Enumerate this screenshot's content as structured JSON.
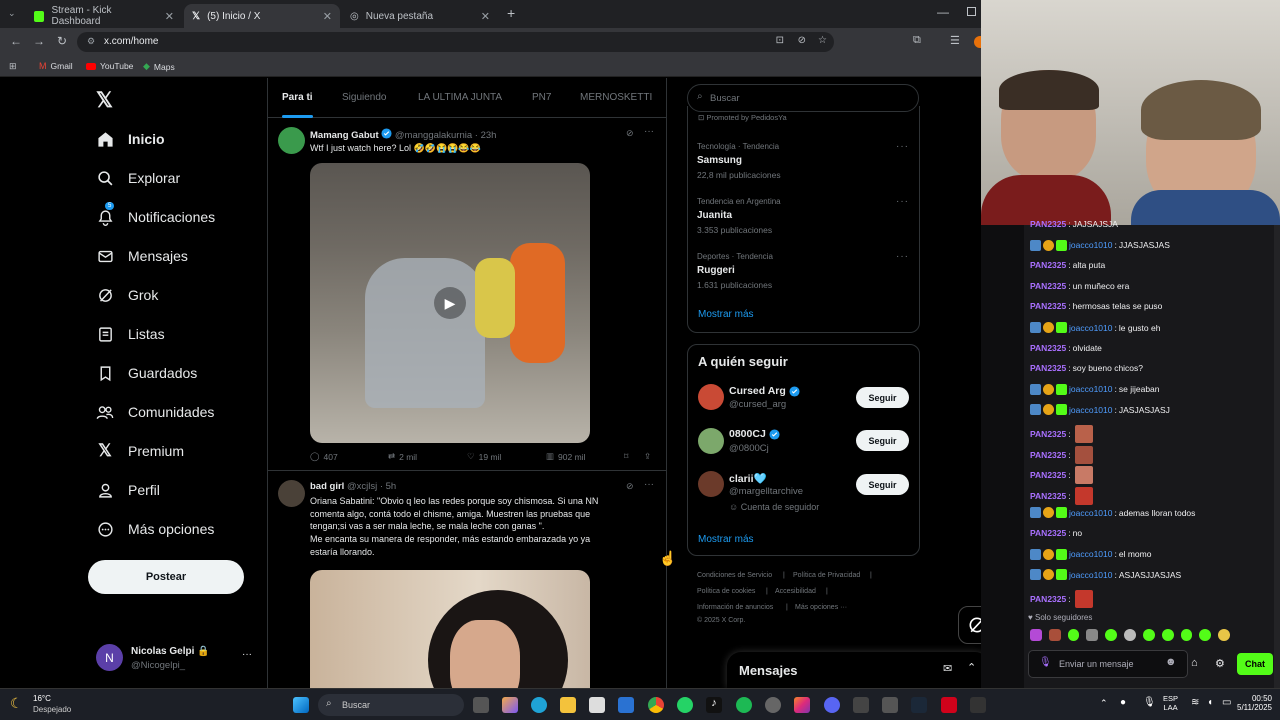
{
  "browser": {
    "tabs": [
      {
        "label": "Stream - Kick Dashboard"
      },
      {
        "label": "(5) Inicio / X"
      },
      {
        "label": "Nueva pestaña"
      }
    ],
    "url": "x.com/home",
    "bookmarks": [
      "Gmail",
      "YouTube",
      "Maps"
    ]
  },
  "x": {
    "nav": [
      {
        "label": "Inicio",
        "icon": "home-icon"
      },
      {
        "label": "Explorar",
        "icon": "search-icon"
      },
      {
        "label": "Notificaciones",
        "icon": "bell-icon",
        "badge": "5"
      },
      {
        "label": "Mensajes",
        "icon": "mail-icon"
      },
      {
        "label": "Grok",
        "icon": "grok-icon"
      },
      {
        "label": "Listas",
        "icon": "list-icon"
      },
      {
        "label": "Guardados",
        "icon": "bookmark-icon"
      },
      {
        "label": "Comunidades",
        "icon": "people-icon"
      },
      {
        "label": "Premium",
        "icon": "x-logo-icon"
      },
      {
        "label": "Perfil",
        "icon": "person-icon"
      },
      {
        "label": "Más opciones",
        "icon": "more-circle-icon"
      }
    ],
    "post_button": "Postear",
    "account": {
      "initial": "N",
      "name": "Nicolas Gelpi",
      "handle": "@Nicogelpi_"
    },
    "timeline_tabs": [
      "Para ti",
      "Siguiendo",
      "LA ULTIMA JUNTA",
      "PN7",
      "MERNOSKETTI"
    ],
    "posts": [
      {
        "name": "Mamang Gabut",
        "handle": "@manggalakurnia · 23h",
        "text": "Wtf I just watch here? Lol 🤣🤣😭😭😂😂",
        "metrics": {
          "replies": "407",
          "reposts": "2 mil",
          "likes": "19 mil",
          "views": "902 mil"
        }
      },
      {
        "name": "bad girl",
        "handle": "@xcjlsj · 5h",
        "text_lines": [
          "Oriana Sabatini: \"Obvio q leo las redes porque soy chismosa. Si una NN",
          "comenta algo, contá todo el chisme, amiga. Muestren las pruebas que",
          "tengan;si vas a ser mala leche, se mala leche con ganas \".",
          "Me encanta su manera de responder, más estando embarazada yo ya",
          "estaría llorando."
        ]
      }
    ],
    "search_placeholder": "Buscar",
    "promoted": "Promoted by PedidosYa",
    "trends": [
      {
        "category": "Tecnología · Tendencia",
        "name": "Samsung",
        "count": "22,8 mil publicaciones"
      },
      {
        "category": "Tendencia en Argentina",
        "name": "Juanita",
        "count": "3.353 publicaciones"
      },
      {
        "category": "Deportes · Tendencia",
        "name": "Ruggeri",
        "count": "1.631 publicaciones"
      }
    ],
    "show_more": "Mostrar más",
    "who_to_follow": {
      "title": "A quién seguir",
      "users": [
        {
          "name": "Cursed Arg",
          "handle": "@cursed_arg",
          "verified": true
        },
        {
          "name": "0800CJ",
          "handle": "@0800Cj",
          "verified": true
        },
        {
          "name": "clarii🩵",
          "handle": "@margelltarchive",
          "note": "Cuenta de seguidor",
          "verified": false
        }
      ],
      "follow_label": "Seguir",
      "show_more": "Mostrar más"
    },
    "footer_links": [
      "Condiciones de Servicio",
      "|",
      "Política de Privacidad",
      "|",
      "Política de cookies",
      "|",
      "Accesibilidad",
      "|",
      "Información de anuncios",
      "|",
      "Más opciones ···",
      "© 2025 X Corp."
    ],
    "messages_label": "Mensajes"
  },
  "chat": {
    "messages": [
      {
        "user": "PAN2325",
        "text": "JAJSAJSJA",
        "type": "pan"
      },
      {
        "user": "joacco1010",
        "text": "JJASJASJAS",
        "type": "joa"
      },
      {
        "user": "PAN2325",
        "text": "alta puta",
        "type": "pan"
      },
      {
        "user": "PAN2325",
        "text": "un muñeco era",
        "type": "pan"
      },
      {
        "user": "PAN2325",
        "text": "hermosas telas se puso",
        "type": "pan"
      },
      {
        "user": "joacco1010",
        "text": "le gusto eh",
        "type": "joa"
      },
      {
        "user": "PAN2325",
        "text": "olvidate",
        "type": "pan"
      },
      {
        "user": "PAN2325",
        "text": "soy bueno chicos?",
        "type": "pan"
      },
      {
        "user": "joacco1010",
        "text": "se jijeaban",
        "type": "joa"
      },
      {
        "user": "joacco1010",
        "text": "JASJASJASJ",
        "type": "joa"
      },
      {
        "user": "PAN2325",
        "text": "",
        "type": "pan",
        "emote": true
      },
      {
        "user": "PAN2325",
        "text": "",
        "type": "pan",
        "emote": true
      },
      {
        "user": "PAN2325",
        "text": "",
        "type": "pan",
        "emote": true
      },
      {
        "user": "PAN2325",
        "text": "",
        "type": "pan",
        "emote": true
      },
      {
        "user": "joacco1010",
        "text": "ademas lloran todos",
        "type": "joa"
      },
      {
        "user": "PAN2325",
        "text": "no",
        "type": "pan"
      },
      {
        "user": "joacco1010",
        "text": "el momo",
        "type": "joa"
      },
      {
        "user": "joacco1010",
        "text": "ASJASJJASJAS",
        "type": "joa"
      },
      {
        "user": "PAN2325",
        "text": "",
        "type": "pan",
        "emote": true
      }
    ],
    "followers_only": "Solo seguidores",
    "input_placeholder": "Enviar un mensaje",
    "send_label": "Chat"
  },
  "taskbar": {
    "weather_temp": "16°C",
    "weather_text": "Despejado",
    "search_placeholder": "Buscar",
    "lang": "ESP",
    "lang2": "LAA",
    "time": "00:50",
    "date": "5/11/2025"
  }
}
